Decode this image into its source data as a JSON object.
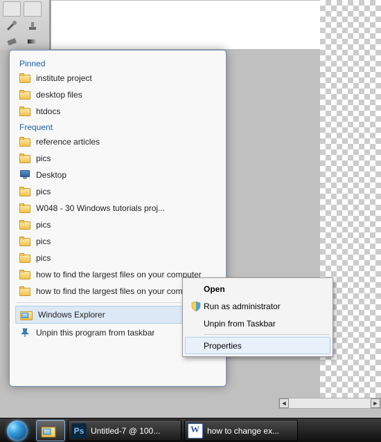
{
  "jumplist": {
    "pinned_header": "Pinned",
    "frequent_header": "Frequent",
    "pinned": [
      {
        "label": "institute project",
        "icon": "folder"
      },
      {
        "label": "desktop files",
        "icon": "folder"
      },
      {
        "label": "htdocs",
        "icon": "folder"
      }
    ],
    "frequent": [
      {
        "label": "reference articles",
        "icon": "folder"
      },
      {
        "label": "pics",
        "icon": "folder"
      },
      {
        "label": "Desktop",
        "icon": "monitor"
      },
      {
        "label": "pics",
        "icon": "folder"
      },
      {
        "label": "W048 - 30 Windows tutorials proj...",
        "icon": "folder"
      },
      {
        "label": "pics",
        "icon": "folder"
      },
      {
        "label": "pics",
        "icon": "folder"
      },
      {
        "label": "pics",
        "icon": "folder"
      },
      {
        "label": "how to find the largest files on your computer",
        "icon": "folder"
      },
      {
        "label": "how to find the largest files on your computer",
        "icon": "folder"
      }
    ],
    "app_item": "Windows Explorer",
    "unpin_item": "Unpin this program from taskbar"
  },
  "context_menu": {
    "open": "Open",
    "runas": "Run as administrator",
    "unpin": "Unpin from Taskbar",
    "properties": "Properties"
  },
  "taskbar": {
    "ps_label": "Untitled-7 @ 100...",
    "word_label": "how to change ex..."
  }
}
